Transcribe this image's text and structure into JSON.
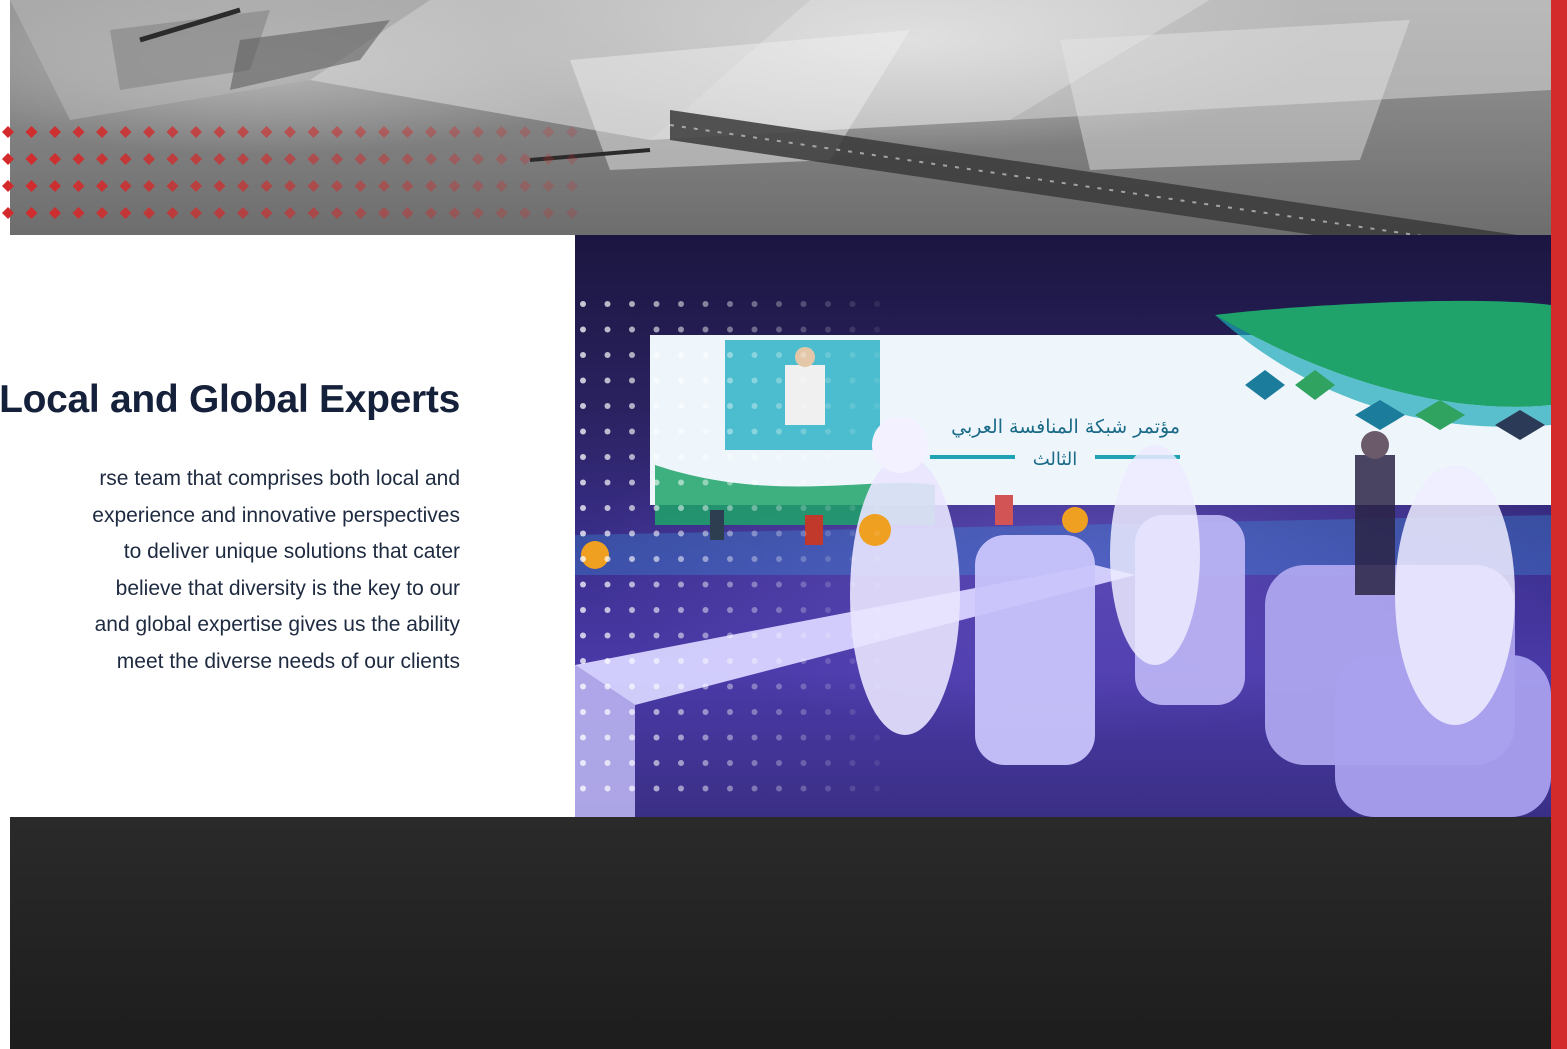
{
  "section": {
    "heading": "Local and Global Experts",
    "body_lines": [
      "rse team that comprises both local and",
      "experience and innovative perspectives",
      "to deliver unique solutions that cater",
      "believe that diversity is the key to our",
      "and global expertise gives us the ability",
      "meet the diverse needs of our clients"
    ]
  },
  "event_photo": {
    "screen_title_ar": "مؤتمر شبكة المنافسة العربي",
    "screen_subtitle_ar": "الثالث"
  },
  "colors": {
    "accent_red": "#d32a2b",
    "heading_navy": "#15203a",
    "body_text": "#1e2a40",
    "stage_green": "#1fa36a",
    "stage_teal": "#19a8b8"
  }
}
